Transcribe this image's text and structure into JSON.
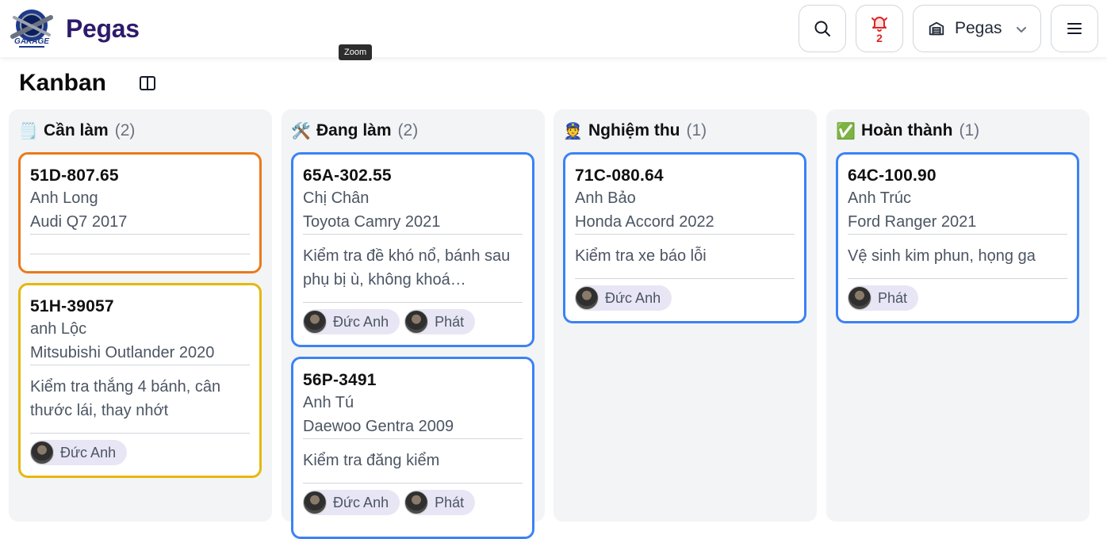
{
  "header": {
    "brand": "Pegas",
    "tooltip": "Zoom",
    "notifications_count": "2",
    "garage_selector": "Pegas",
    "icons": {
      "search": "search-icon",
      "bell": "bell-icon",
      "garage": "garage-icon",
      "menu": "hamburger-menu-icon",
      "chevron": "chevron-down-icon"
    }
  },
  "page": {
    "title": "Kanban",
    "toggle_icon": "panel-toggle-icon"
  },
  "columns": [
    {
      "emoji": "🗒️",
      "title": "Cần làm",
      "count": "(2)",
      "cards": [
        {
          "plate": "51D-807.65",
          "customer": "Anh Long",
          "vehicle": "Audi Q7 2017",
          "description": "",
          "assignees": [],
          "border": "#ea7a1a"
        },
        {
          "plate": "51H-39057",
          "customer": "anh Lộc",
          "vehicle": "Mitsubishi Outlander 2020",
          "description": "Kiểm tra thắng 4 bánh, cân thước lái, thay nhớt",
          "assignees": [
            "Đức Anh"
          ],
          "border": "#e5b80b"
        }
      ]
    },
    {
      "emoji": "🛠️",
      "title": "Đang làm",
      "count": "(2)",
      "cards": [
        {
          "plate": "65A-302.55",
          "customer": "Chị Chân",
          "vehicle": "Toyota Camry 2021",
          "description": "Kiểm tra đề khó nổ, bánh sau phụ bị ù, không khoá…",
          "assignees": [
            "Đức Anh",
            "Phát"
          ],
          "border": "#3b82f6"
        },
        {
          "plate": "56P-3491",
          "customer": "Anh Tú",
          "vehicle": "Daewoo Gentra 2009",
          "description": "Kiểm tra đăng kiểm",
          "assignees": [
            "Đức Anh",
            "Phát"
          ],
          "border": "#3b82f6"
        }
      ]
    },
    {
      "emoji": "👮",
      "title": "Nghiệm thu",
      "count": "(1)",
      "cards": [
        {
          "plate": "71C-080.64",
          "customer": "Anh Bảo",
          "vehicle": "Honda Accord 2022",
          "description": "Kiểm tra xe báo lỗi",
          "assignees": [
            "Đức Anh"
          ],
          "border": "#3b82f6"
        }
      ]
    },
    {
      "emoji": "✅",
      "title": "Hoàn thành",
      "count": "(1)",
      "cards": [
        {
          "plate": "64C-100.90",
          "customer": "Anh Trúc",
          "vehicle": "Ford Ranger 2021",
          "description": "Vệ sinh kim phun, họng ga",
          "assignees": [
            "Phát"
          ],
          "border": "#3b82f6"
        }
      ]
    }
  ]
}
